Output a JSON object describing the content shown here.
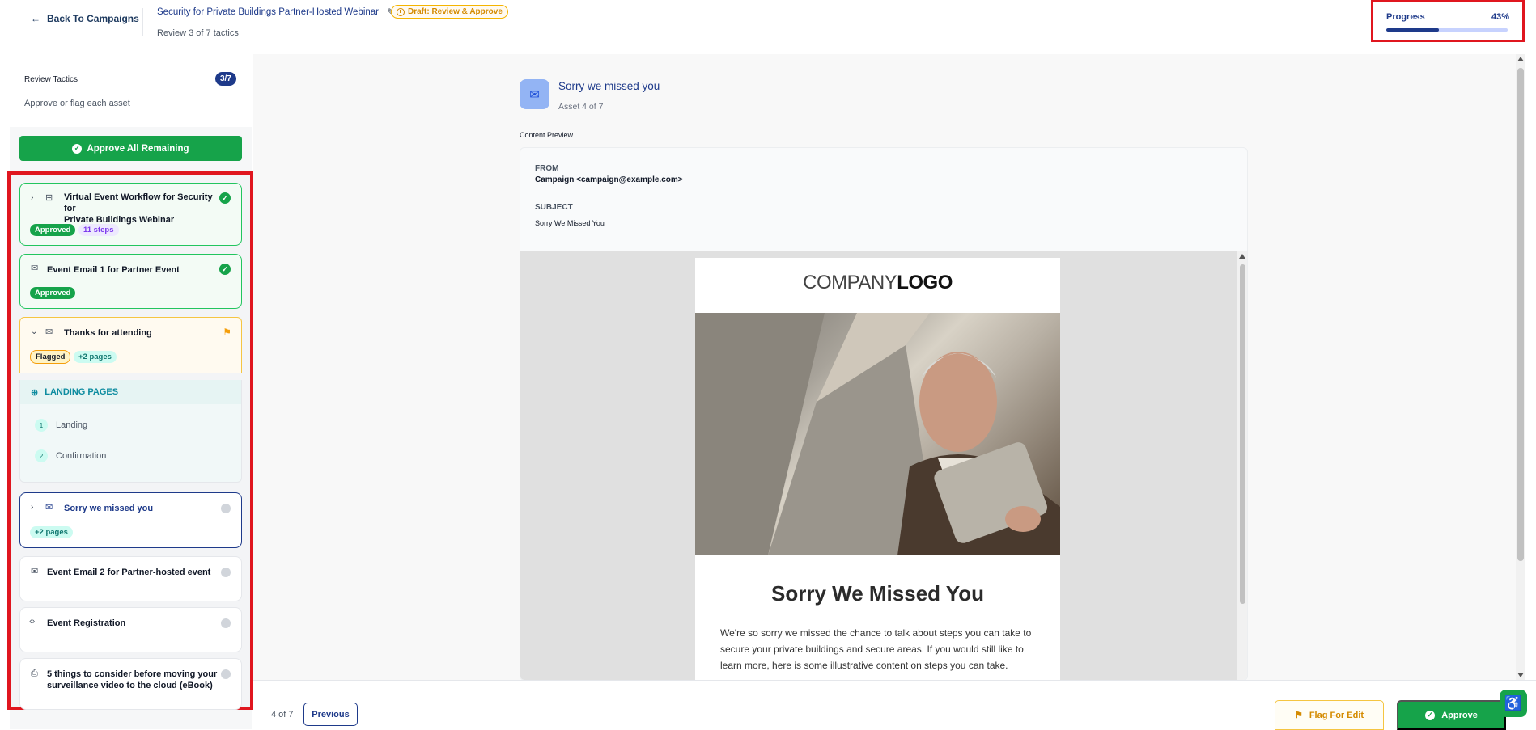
{
  "header": {
    "back_label": "Back To Campaigns",
    "campaign_title": "Security for Private Buildings Partner-Hosted Webinar",
    "status_badge": "Draft: Review & Approve",
    "review_count": "Review 3 of 7 tactics",
    "progress_label": "Progress",
    "progress_pct": "43%",
    "progress_fraction": 0.43
  },
  "sidebar": {
    "title": "Review Tactics",
    "subtitle": "Approve or flag each asset",
    "count_badge": "3/7",
    "approve_all_label": "Approve All Remaining",
    "tactics": [
      {
        "title_line1": "Virtual Event Workflow for Security for",
        "title_line2": "Private Buildings Webinar",
        "icon": "workflow-icon",
        "status": "approved",
        "badge1": "Approved",
        "badge2": "11 steps"
      },
      {
        "title": "Event Email 1 for Partner Event",
        "icon": "envelope-icon",
        "status": "approved",
        "badge1": "Approved"
      },
      {
        "title": "Thanks for attending",
        "icon": "envelope-icon",
        "status": "flagged",
        "badge1": "Flagged",
        "badge2": "+2 pages"
      },
      {
        "title": "Sorry we missed you",
        "icon": "envelope-icon",
        "status": "pending",
        "badge1": "+2 pages"
      },
      {
        "title": "Event Email 2 for Partner-hosted event",
        "icon": "envelope-icon",
        "status": "pending"
      },
      {
        "title": "Event Registration",
        "icon": "code-icon",
        "status": "pending"
      },
      {
        "title_line1": "5 things to consider before moving your",
        "title_line2": "surveillance video to the cloud (eBook)",
        "icon": "print-icon",
        "status": "pending"
      }
    ],
    "landing_pages": {
      "header": "LANDING PAGES",
      "items": [
        {
          "num": "1",
          "label": "Landing"
        },
        {
          "num": "2",
          "label": "Confirmation"
        }
      ]
    }
  },
  "main": {
    "asset_title": "Sorry we missed you",
    "asset_sub": "Asset 4 of 7",
    "content_preview_label": "Content Preview",
    "from_label": "FROM",
    "from_value": "Campaign <campaign@example.com>",
    "subject_label": "SUBJECT",
    "subject_value": "Sorry We Missed You",
    "email": {
      "logo_light": "COMPANY",
      "logo_bold": "LOGO",
      "heading": "Sorry We Missed You",
      "body": "We're so sorry we missed the chance to talk about steps you can take to secure your private buildings and secure areas. If you would still like to learn more, here is some illustrative content on steps you can take."
    }
  },
  "footer": {
    "page_info": "4 of 7",
    "previous_label": "Previous",
    "flag_label": "Flag For Edit",
    "approve_label": "Approve"
  },
  "colors": {
    "brand_navy": "#1e3a8a",
    "approve_green": "#16a34a",
    "flag_amber": "#f59e0b",
    "highlight_red": "#e0161f"
  }
}
